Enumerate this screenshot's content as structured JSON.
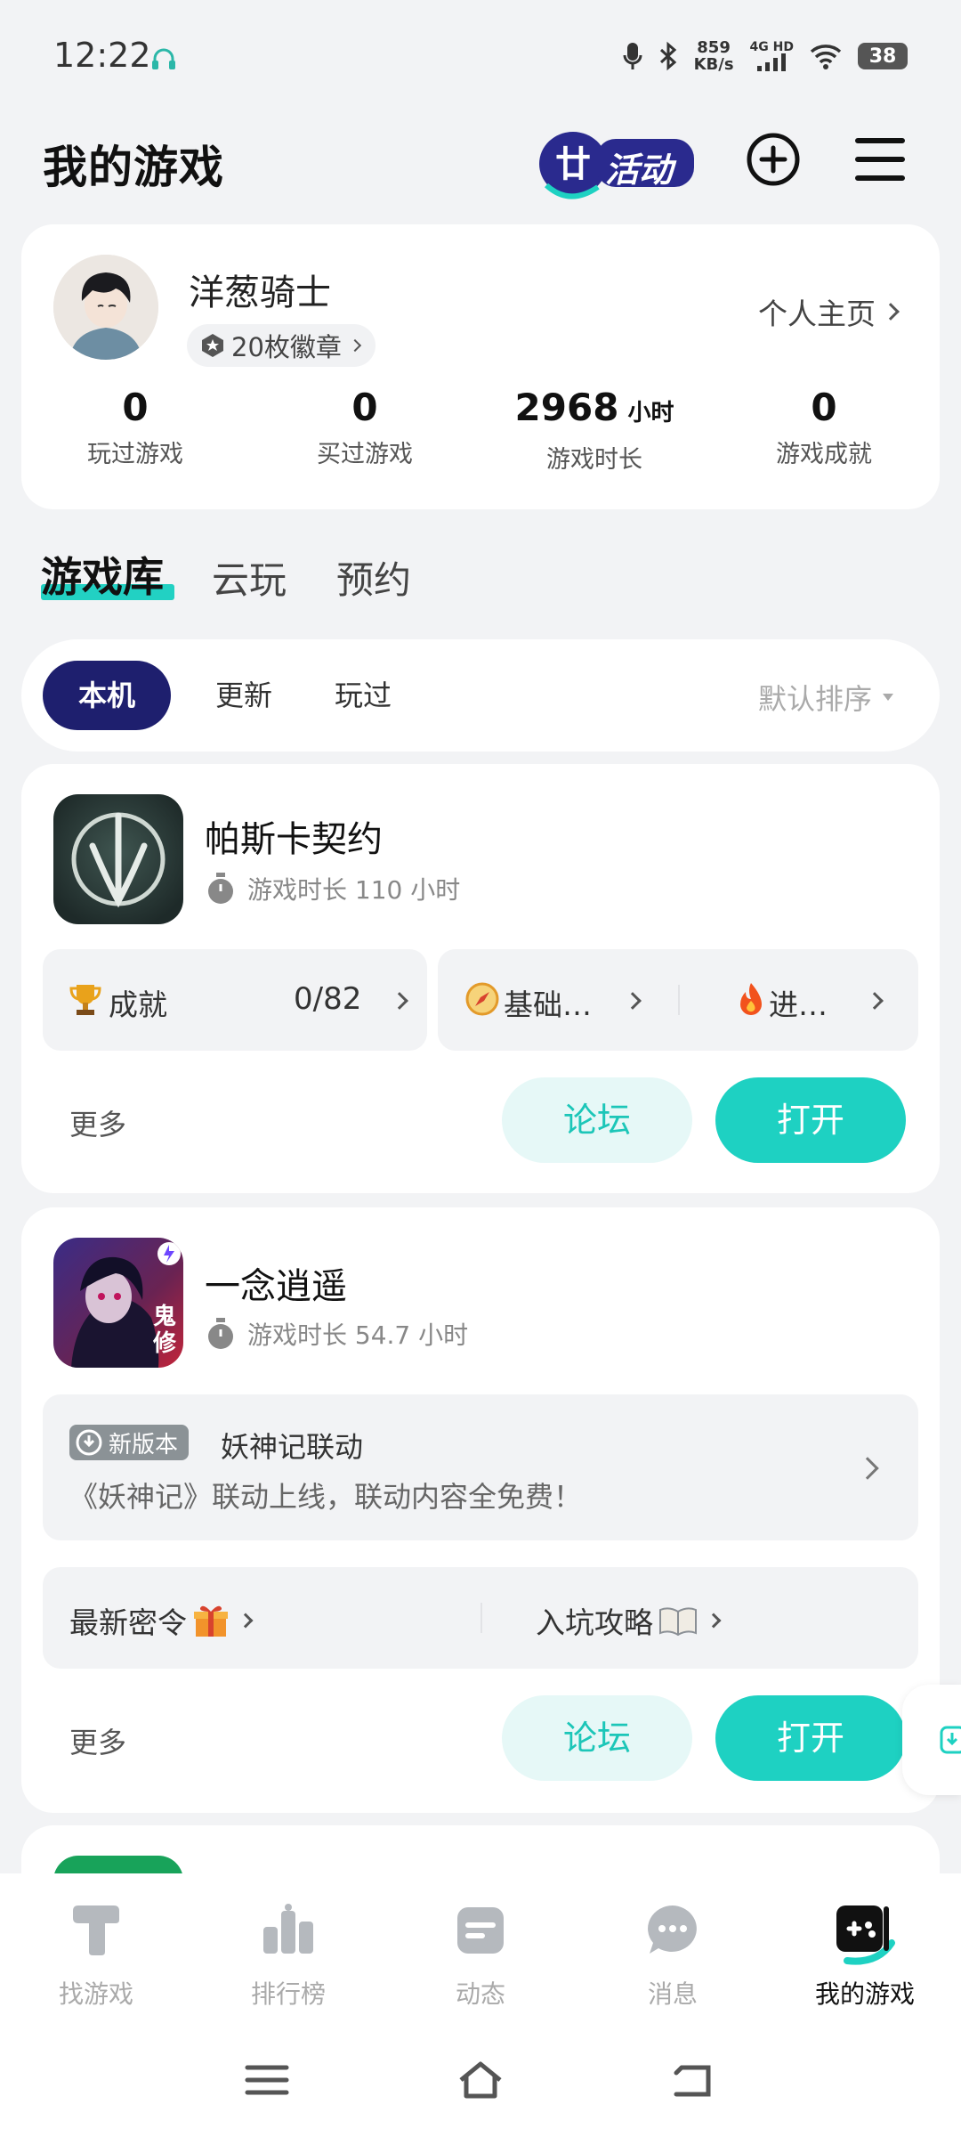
{
  "status_bar": {
    "time": "12:22",
    "net_speed_top": "859",
    "net_speed_bottom": "KB/s",
    "network": "4G HD",
    "battery": "38"
  },
  "header": {
    "title": "我的游戏",
    "activity_badge": "活动"
  },
  "profile": {
    "username": "洋葱骑士",
    "badges": "20枚徽章",
    "homepage_link": "个人主页",
    "stats": [
      {
        "value": "0",
        "unit": "",
        "label": "玩过游戏"
      },
      {
        "value": "0",
        "unit": "",
        "label": "买过游戏"
      },
      {
        "value": "2968",
        "unit": "小时",
        "label": "游戏时长"
      },
      {
        "value": "0",
        "unit": "",
        "label": "游戏成就"
      }
    ]
  },
  "main_tabs": [
    "游戏库",
    "云玩",
    "预约"
  ],
  "filter": {
    "chips": [
      "本机",
      "更新",
      "玩过"
    ],
    "sort": "默认排序"
  },
  "games": [
    {
      "name": "帕斯卡契约",
      "playtime": "游戏时长 110 小时",
      "achievement_label": "成就",
      "achievement_value": "0/82",
      "guide_1": "基础…",
      "guide_2": "进…",
      "more": "更多",
      "forum": "论坛",
      "open": "打开"
    },
    {
      "name": "一念逍遥",
      "playtime": "游戏时长 54.7 小时",
      "news_tag": "新版本",
      "news_title": "妖神记联动",
      "news_desc": "《妖神记》联动上线，联动内容全免费！",
      "link_1": "最新密令",
      "link_2": "入坑攻略",
      "icon_text": "鬼修",
      "more": "更多",
      "forum": "论坛",
      "open": "打开"
    }
  ],
  "bottom_nav": [
    {
      "label": "找游戏",
      "icon": "find-games-icon"
    },
    {
      "label": "排行榜",
      "icon": "ranking-icon"
    },
    {
      "label": "动态",
      "icon": "feed-icon"
    },
    {
      "label": "消息",
      "icon": "message-icon"
    },
    {
      "label": "我的游戏",
      "icon": "my-games-icon",
      "active": true
    }
  ],
  "colors": {
    "accent": "#1ed1c2",
    "chip_active": "#1e1f6e",
    "background": "#f2f3f5"
  }
}
